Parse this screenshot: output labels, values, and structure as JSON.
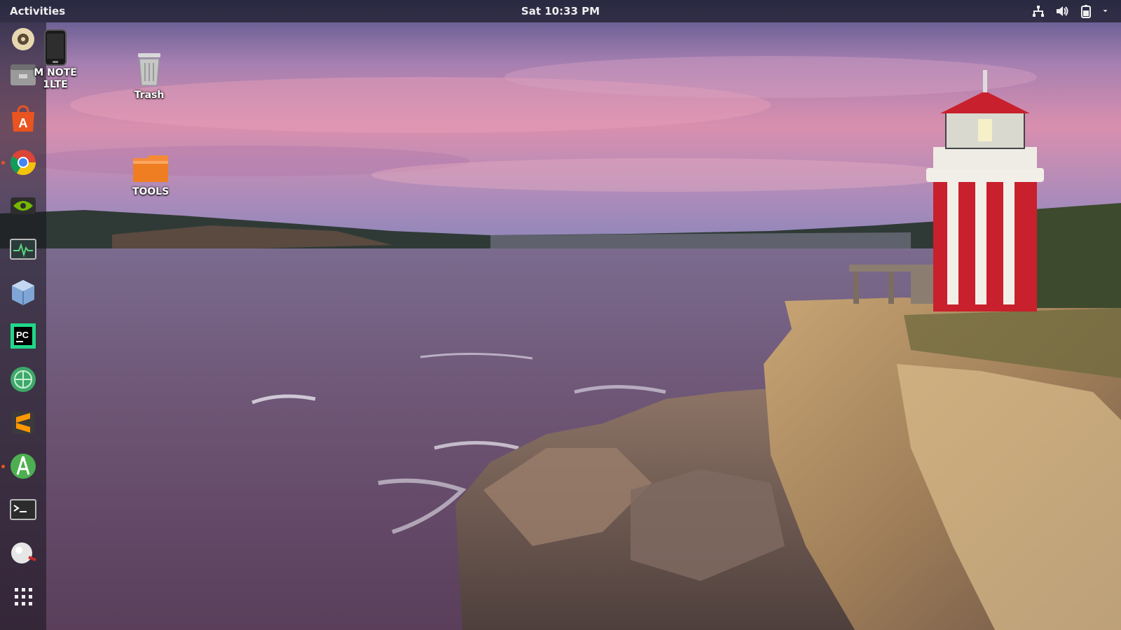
{
  "topbar": {
    "activities": "Activities",
    "clock": "Sat 10:33 PM",
    "tray": [
      "network-icon",
      "volume-icon",
      "battery-icon",
      "system-menu-chevron-icon"
    ]
  },
  "dock": {
    "items": [
      "rhythmbox-icon",
      "files-icon",
      "software-center-icon",
      "chrome-icon",
      "nvidia-settings-icon",
      "system-monitor-icon",
      "virtualbox-icon",
      "pycharm-icon",
      "network-globe-icon",
      "sublime-text-icon",
      "android-studio-icon",
      "terminal-icon",
      "anaconda-icon",
      "show-applications-icon"
    ]
  },
  "desktop": {
    "icons": [
      {
        "name": "phone-device",
        "label": "M NOTE 1LTE"
      },
      {
        "name": "trash",
        "label": "Trash"
      },
      {
        "name": "tools-folder",
        "label": "TOOLS"
      }
    ]
  },
  "colors": {
    "accent": "#e95420",
    "sky_top": "#5b5a8c",
    "sky_pink": "#d88aa8",
    "sea": "#6d5678",
    "cliff": "#b7935e",
    "lighthouse_red": "#c8202c"
  }
}
